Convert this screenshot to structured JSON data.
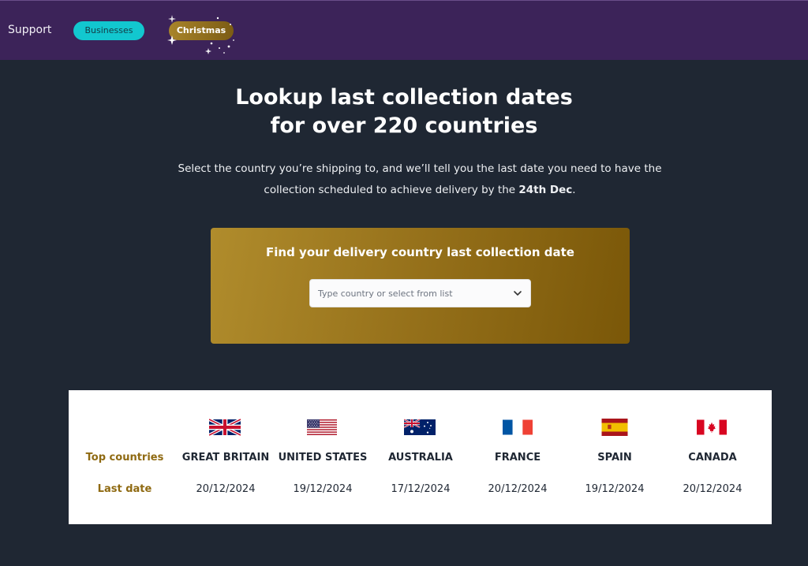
{
  "nav": {
    "support": "Support",
    "businesses": "Businesses",
    "christmas": "Christmas"
  },
  "hero": {
    "title_line1": "Lookup last collection dates",
    "title_line2": "for over 220 countries",
    "subtitle_line1": "Select the country you’re shipping to, and we’ll tell you the last date you need to have the",
    "subtitle_line2_prefix": "collection scheduled to achieve delivery by the ",
    "subtitle_bold": "24th Dec",
    "subtitle_suffix": "."
  },
  "finder": {
    "title": "Find your delivery country last collection date",
    "placeholder": "Type country or select from list",
    "icon": "chevron-down-icon"
  },
  "table": {
    "top_label": "Top countries",
    "date_label": "Last date",
    "countries": [
      {
        "name": "GREAT BRITAIN",
        "date": "20/12/2024",
        "flag": "uk-flag-icon"
      },
      {
        "name": "UNITED STATES",
        "date": "19/12/2024",
        "flag": "us-flag-icon"
      },
      {
        "name": "AUSTRALIA",
        "date": "17/12/2024",
        "flag": "australia-flag-icon"
      },
      {
        "name": "FRANCE",
        "date": "20/12/2024",
        "flag": "france-flag-icon"
      },
      {
        "name": "SPAIN",
        "date": "19/12/2024",
        "flag": "spain-flag-icon"
      },
      {
        "name": "CANADA",
        "date": "20/12/2024",
        "flag": "canada-flag-icon"
      }
    ]
  },
  "colors": {
    "topbar": "#3c2359",
    "background": "#1f2733",
    "accent_cyan": "#12c7cf",
    "gold": "#8f6a12"
  }
}
